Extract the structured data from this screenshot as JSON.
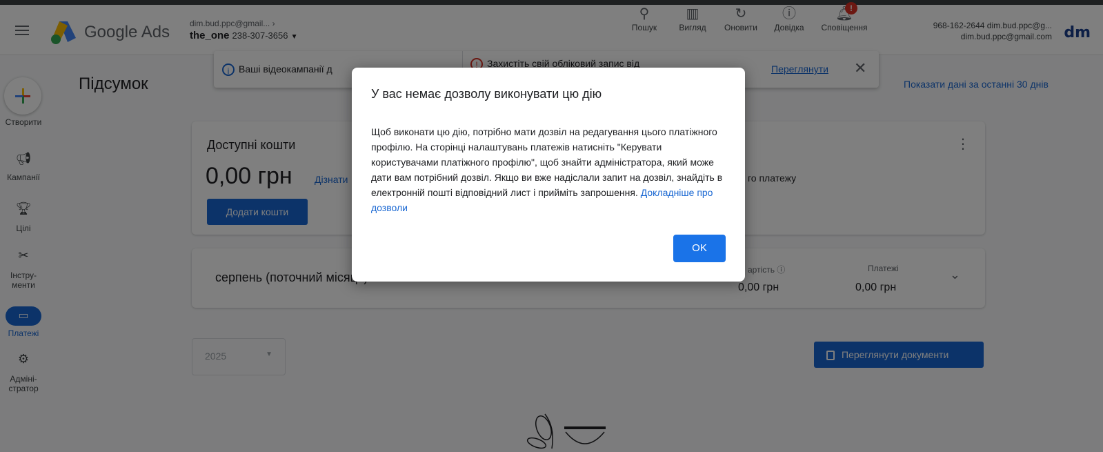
{
  "header": {
    "brand": "Google Ads",
    "account_email": "dim.bud.ppc@gmail...",
    "account_name": "the_one",
    "account_number": "238-307-3656",
    "tools": [
      {
        "label": "Пошук",
        "icon": "search-icon"
      },
      {
        "label": "Вигляд",
        "icon": "view-icon"
      },
      {
        "label": "Оновити",
        "icon": "refresh-icon"
      },
      {
        "label": "Довідка",
        "icon": "help-icon"
      },
      {
        "label": "Сповіщення",
        "icon": "bell-icon",
        "badge": "!"
      }
    ],
    "user_line1": "968-162-2644 dim.bud.ppc@g...",
    "user_line2": "dim.bud.ppc@gmail.com",
    "avatar_text": "dm"
  },
  "sidenav": {
    "create_label": "Створити",
    "items": [
      {
        "label": "Кампанії",
        "icon": "megaphone-icon"
      },
      {
        "label": "Цілі",
        "icon": "trophy-icon"
      },
      {
        "label": "Інстру-\nменти",
        "icon": "tools-icon"
      },
      {
        "label": "Платежі",
        "icon": "card-icon",
        "active": true
      },
      {
        "label": "Адміні-\nстратор",
        "icon": "gear-icon"
      }
    ]
  },
  "page": {
    "title": "Підсумок",
    "show_data_link": "Показати дані за останні 30 днів"
  },
  "banner": {
    "video_msg": "Ваші відеокампанії д",
    "security_msg": "Захистіть свій обліковий запис від",
    "review_link": "Переглянути"
  },
  "funds_card": {
    "label": "Доступні кошти",
    "amount": "0,00 грн",
    "learn_more": "Дізнати",
    "add_button": "Додати кошти",
    "payment_text": "го платежу"
  },
  "month_card": {
    "label": "серпень (поточний місяць)",
    "cost_label": "артість ⓘ",
    "cost_value": "0,00 грн",
    "payments_label": "Платежі",
    "payments_value": "0,00 грн"
  },
  "year_select": {
    "value": "2025"
  },
  "docs_button": "Переглянути документи",
  "dialog": {
    "title": "У вас немає дозволу виконувати цю дію",
    "body": "Щоб виконати цю дію, потрібно мати дозвіл на редагування цього платіжного профілю. На сторінці налаштувань платежів натисніть \"Керувати користувачами платіжного профілю\", щоб знайти адміністратора, який може дати вам потрібний дозвіл. Якщо ви вже надіслали запит на дозвіл, знайдіть в електронній пошті відповідний лист і прийміть запрошення.",
    "link": "Докладніше про дозволи",
    "ok_label": "OK"
  },
  "colors": {
    "accent": "#1a73e8",
    "link": "#1967d2",
    "alert": "#d93025"
  }
}
